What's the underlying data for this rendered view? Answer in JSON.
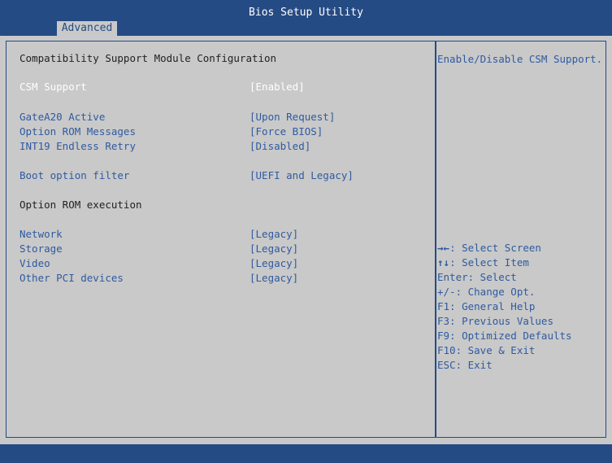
{
  "header": {
    "title": "Bios Setup Utility",
    "tab": "Advanced"
  },
  "section_title": "Compatibility Support Module Configuration",
  "settings": {
    "csm_support": {
      "label": "CSM Support",
      "value": "[Enabled]"
    },
    "gatea20": {
      "label": "GateA20 Active",
      "value": "[Upon Request]"
    },
    "option_rom_messages": {
      "label": "Option ROM Messages",
      "value": "[Force BIOS]"
    },
    "int19_retry": {
      "label": "INT19 Endless Retry",
      "value": "[Disabled]"
    },
    "boot_filter": {
      "label": "Boot option filter",
      "value": "[UEFI and Legacy]"
    },
    "network": {
      "label": "Network",
      "value": "[Legacy]"
    },
    "storage": {
      "label": "Storage",
      "value": "[Legacy]"
    },
    "video": {
      "label": "Video",
      "value": "[Legacy]"
    },
    "other_pci": {
      "label": "Other PCI devices",
      "value": "[Legacy]"
    }
  },
  "subsection_title": "Option ROM execution",
  "help": {
    "description": "Enable/Disable CSM Support.",
    "keys": [
      {
        "arrow": "→←",
        "text": ": Select Screen"
      },
      {
        "arrow": "↑↓",
        "text": ": Select Item"
      },
      {
        "text": "Enter: Select"
      },
      {
        "text": "+/-: Change Opt."
      },
      {
        "text": "F1: General Help"
      },
      {
        "text": "F3: Previous Values"
      },
      {
        "text": "F9: Optimized Defaults"
      },
      {
        "text": "F10: Save & Exit"
      },
      {
        "text": "ESC: Exit"
      }
    ]
  },
  "colors": {
    "bar": "#254b84",
    "panel_bg": "#c9c9c9",
    "text_blue": "#2f5aa0",
    "text_dark": "#222222"
  }
}
